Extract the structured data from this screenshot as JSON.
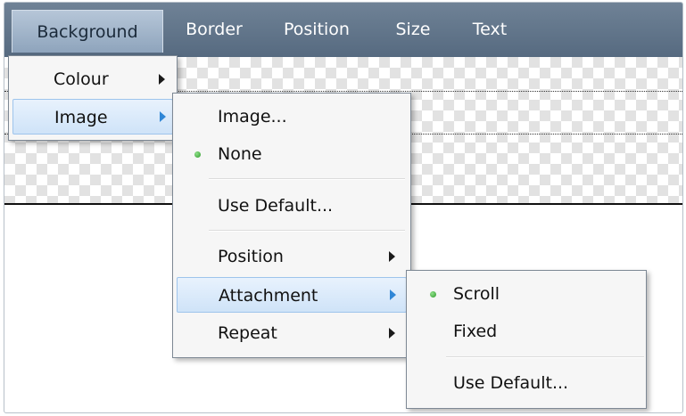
{
  "menubar": {
    "items": [
      "Background",
      "Border",
      "Position",
      "Size",
      "Text"
    ]
  },
  "menu1": {
    "items": [
      {
        "label": "Colour",
        "has_submenu": true,
        "highlighted": false
      },
      {
        "label": "Image",
        "has_submenu": true,
        "highlighted": true
      }
    ]
  },
  "menu2": {
    "items": [
      {
        "label": "Image...",
        "checked": false
      },
      {
        "label": "None",
        "checked": true
      },
      {
        "label": "Use Default...",
        "checked": false
      },
      {
        "label": "Position",
        "has_submenu": true
      },
      {
        "label": "Attachment",
        "has_submenu": true,
        "highlighted": true
      },
      {
        "label": "Repeat",
        "has_submenu": true
      }
    ]
  },
  "menu3": {
    "items": [
      {
        "label": "Scroll",
        "checked": true
      },
      {
        "label": "Fixed",
        "checked": false
      },
      {
        "label": "Use Default...",
        "checked": false
      }
    ]
  },
  "colors": {
    "menubar": "#5f7389",
    "highlight": "#cfe3f8",
    "check_dot": "#2f9a2b",
    "submenu_arrow_active": "#2f86d6"
  }
}
